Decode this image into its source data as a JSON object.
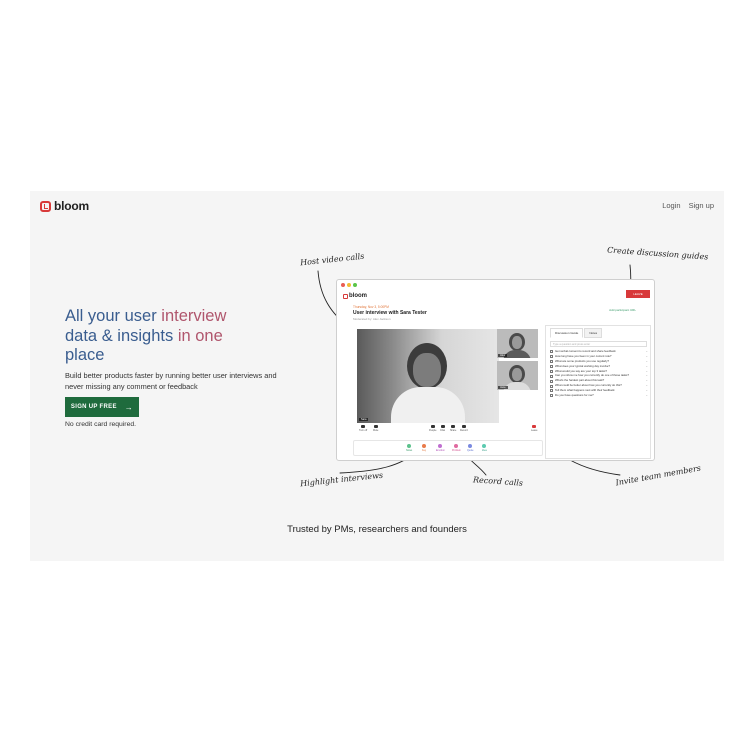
{
  "brand": {
    "name": "bloom",
    "accent": "#d83a3a"
  },
  "nav": {
    "login": "Login",
    "signup": "Sign up"
  },
  "hero": {
    "title_parts": [
      {
        "text": "All your user ",
        "color": "blue"
      },
      {
        "text": "interview",
        "color": "pink"
      },
      {
        "text": "data & insights ",
        "color": "blue"
      },
      {
        "text": "in one",
        "color": "pink"
      },
      {
        "text": "place",
        "color": "blue"
      }
    ],
    "subtitle": "Build better products faster by running better user interviews and never missing any comment or feedback",
    "cta_label": "SIGN UP FREE",
    "cta_icon": "arrow-right-icon",
    "no_card": "No credit card required."
  },
  "annotations": {
    "host": "Host video calls",
    "guides": "Create discussion guides",
    "highlight": "Highlight interviews",
    "record": "Record calls",
    "invite": "Invite team members"
  },
  "screenshot": {
    "leave": "LEAVE",
    "date": "Thursday, Nov 3, 5:00PM",
    "title": "User interview with Sara Tester",
    "moderator": "Moderated by: Alex Jackson",
    "add_participant": "Add participant URL",
    "main_label": "Sara",
    "small_labels": [
      "Alex",
      "Jane"
    ],
    "controls": {
      "left": [
        "Turn off",
        "Mute"
      ],
      "center": [
        "People",
        "Chat",
        "Share",
        "Record"
      ],
      "right": "Leave"
    },
    "highlights": [
      "Notes",
      "Key",
      "Emotion",
      "Problem",
      "Quote",
      "Idea"
    ],
    "tabs": [
      "Discussion Guide",
      "Notes"
    ],
    "search_placeholder": "Type a question and press enter",
    "questions": [
      "Get verbal consent to record and share feedback",
      "How long have you been in your current role?",
      "What are some products you use regularly?",
      "What does your typical working day involve?",
      "What would you say are your top 3 tasks?",
      "Can you show me how you currently do one of those tasks?",
      "What's the hardest part about this task?",
      "What could be better about how you currently do this?",
      "Tell them what happens next with their feedback",
      "Do you have questions for me?"
    ]
  },
  "trusted": "Trusted by PMs, researchers and founders",
  "colors": {
    "cta_bg": "#1f6b3d",
    "title_blue": "#3a5d8f",
    "title_pink": "#b0566d",
    "leave_red": "#d8393a"
  }
}
